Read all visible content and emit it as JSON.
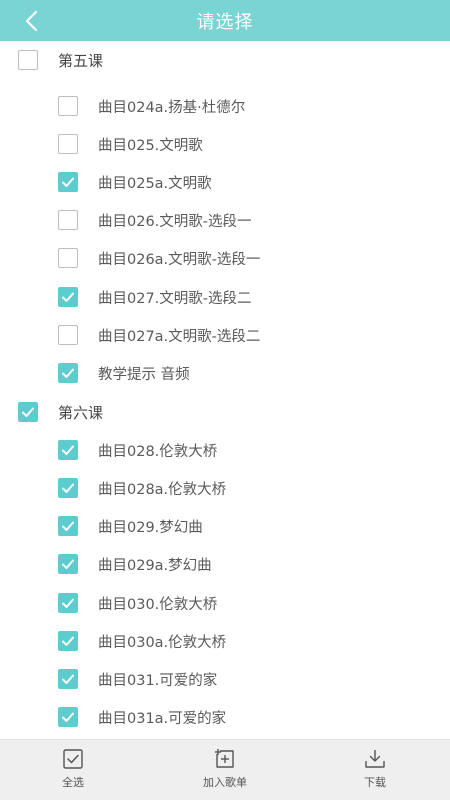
{
  "header": {
    "title": "请选择"
  },
  "lessons": [
    {
      "label": "第五课",
      "checked": false
    },
    {
      "label": "曲目024a.扬基·杜德尔",
      "checked": false
    },
    {
      "label": "曲目025.文明歌",
      "checked": false
    },
    {
      "label": "曲目025a.文明歌",
      "checked": true
    },
    {
      "label": "曲目026.文明歌-选段一",
      "checked": false
    },
    {
      "label": "曲目026a.文明歌-选段一",
      "checked": false
    },
    {
      "label": "曲目027.文明歌-选段二",
      "checked": true
    },
    {
      "label": "曲目027a.文明歌-选段二",
      "checked": false
    },
    {
      "label": "教学提示 音频",
      "checked": true
    },
    {
      "label": "第六课",
      "checked": true
    },
    {
      "label": "曲目028.伦敦大桥",
      "checked": true
    },
    {
      "label": "曲目028a.伦敦大桥",
      "checked": true
    },
    {
      "label": "曲目029.梦幻曲",
      "checked": true
    },
    {
      "label": "曲目029a.梦幻曲",
      "checked": true
    },
    {
      "label": "曲目030.伦敦大桥",
      "checked": true
    },
    {
      "label": "曲目030a.伦敦大桥",
      "checked": true
    },
    {
      "label": "曲目031.可爱的家",
      "checked": true
    },
    {
      "label": "曲目031a.可爱的家",
      "checked": true
    }
  ],
  "bottom": {
    "select_all": "全选",
    "add_playlist": "加入歌单",
    "download": "下载"
  },
  "colors": {
    "header": "#7ad4d4",
    "check": "#5ccccf"
  }
}
